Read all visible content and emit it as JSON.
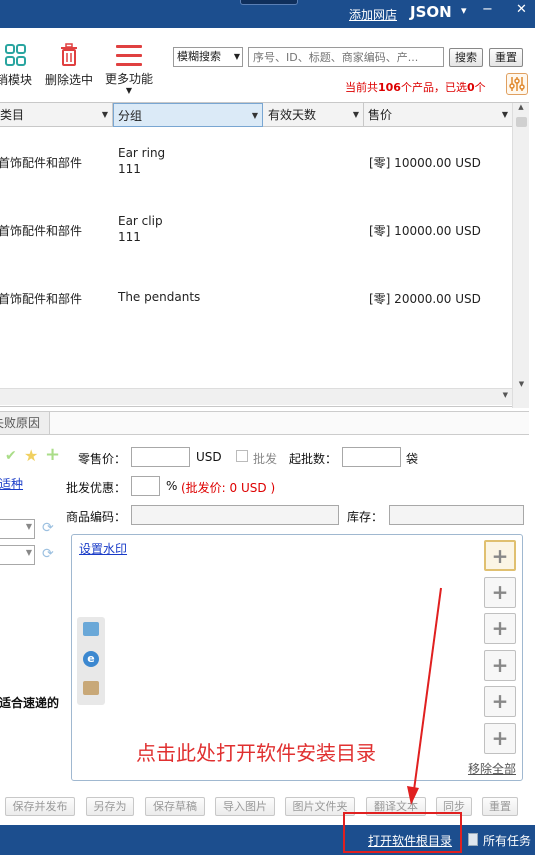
{
  "titlebar": {
    "add_store": "添加网店",
    "account": "JSON",
    "dropdown_glyph": "▾",
    "minimize_glyph": "−",
    "close_glyph": "✕"
  },
  "toolbar": {
    "module_label": "销模块",
    "delete_selected": "删除选中",
    "more_functions": "更多功能",
    "search_mode": "模糊搜索",
    "search_placeholder": "序号、ID、标题、商家编码、产...",
    "search_button": "搜索",
    "reset_button": "重置",
    "count_prefix": "当前共",
    "count_total": "106",
    "count_mid": "个产品，已选",
    "count_selected": "0",
    "count_suffix": "个"
  },
  "grid": {
    "columns": [
      "类目",
      "分组",
      "有效天数",
      "售价"
    ],
    "rows": [
      {
        "category": "首饰配件和部件",
        "group": "Ear ring",
        "group_sub": "111",
        "days": "",
        "price": "[零] 10000.00 USD"
      },
      {
        "category": "首饰配件和部件",
        "group": "Ear clip",
        "group_sub": "111",
        "days": "",
        "price": "[零] 10000.00 USD"
      },
      {
        "category": "首饰配件和部件",
        "group": "The pendants",
        "group_sub": "",
        "days": "",
        "price": "[零] 20000.00 USD"
      }
    ]
  },
  "detail": {
    "fail_reason_tab": "失败原因",
    "retail_price_label": "零售价：",
    "currency": "USD",
    "wholesale_label": "批发",
    "min_batch_label": "起批数：",
    "unit": "袋",
    "wholesale_discount_label": "批发优惠：",
    "percent": "%",
    "wholesale_price_note": "(批发价: 0 USD )",
    "product_code_label": "商品编码：",
    "stock_label": "库存：",
    "left_link": "适种",
    "left_bold_text": "适合速递的",
    "set_watermark": "设置水印",
    "remove_all": "移除全部"
  },
  "annotation": {
    "text": "点击此处打开软件安装目录"
  },
  "bottom_buttons": [
    "保存并发布",
    "另存为",
    "保存草稿",
    "导入图片",
    "图片文件夹",
    "翻译文本",
    "同步",
    "重置"
  ],
  "statusbar": {
    "open_dir": "打开软件根目录",
    "all_tasks": "所有任务"
  },
  "colors": {
    "titlebar": "#1c4e8e",
    "accent_red": "#d00000",
    "annotation_red": "#e03030"
  }
}
